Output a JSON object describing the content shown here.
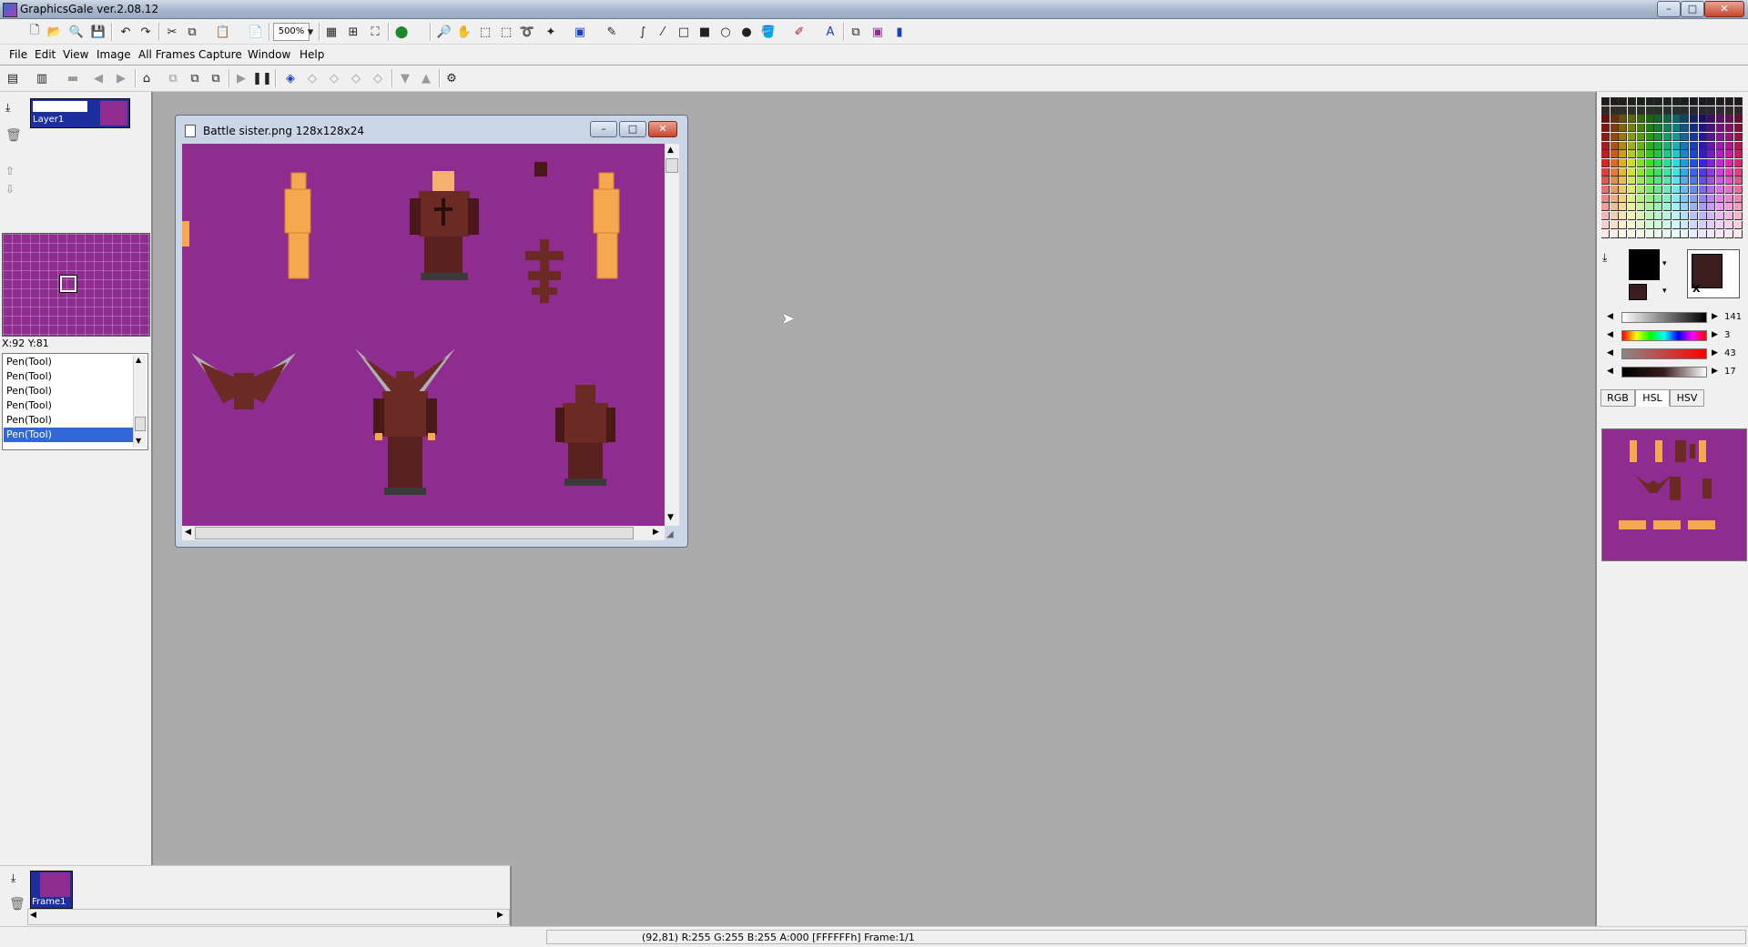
{
  "window": {
    "title": "GraphicsGale ver.2.08.12",
    "controls": [
      "–",
      "□",
      "✕"
    ]
  },
  "toolbar1": {
    "zoom_value": "500%"
  },
  "menu": [
    "File",
    "Edit",
    "View",
    "Image",
    "All Frames",
    "Capture",
    "Window",
    "Help"
  ],
  "layers": {
    "layer_name": "Layer1"
  },
  "navigator": {
    "coords": "X:92 Y:81"
  },
  "history": {
    "items": [
      "Pen(Tool)",
      "Pen(Tool)",
      "Pen(Tool)",
      "Pen(Tool)",
      "Pen(Tool)",
      "Pen(Tool)"
    ],
    "selected_index": 5
  },
  "document": {
    "title": "Battle sister.png 128x128x24"
  },
  "frames": {
    "frame_name": "Frame1"
  },
  "color_panel": {
    "primary_color": "#000000",
    "secondary_color": "#3b1d1d",
    "transparent_label": "X",
    "values": [
      "141",
      "3",
      "43",
      "17"
    ],
    "tabs": [
      "RGB",
      "HSL",
      "HSV"
    ],
    "active_tab": "HSL"
  },
  "statusbar": {
    "text": "(92,81) R:255 G:255 B:255 A:000  [FFFFFFh]  Frame:1/1"
  },
  "colors": {
    "canvas_bg": "#8f2c8f",
    "skin": "#f5a850",
    "armor": "#6b2a24",
    "wing": "#b0b0b0",
    "selection": "#3168d6"
  }
}
